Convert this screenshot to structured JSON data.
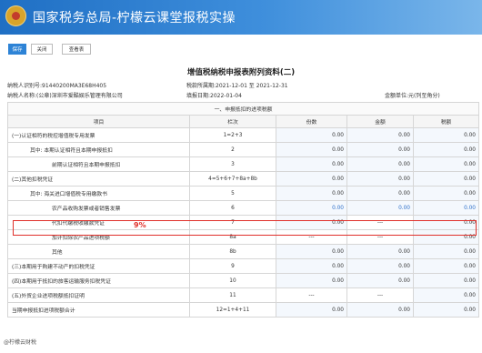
{
  "header": {
    "title": "国家税务总局-柠檬云课堂报税实操"
  },
  "toolbar": {
    "save": "保存",
    "close": "关闭",
    "view": "查看表"
  },
  "form": {
    "title": "增值税纳税申报表附列资料(二)",
    "taxpayer_id_label": "纳税人识别号:",
    "taxpayer_id": "91440200MA3E68H405",
    "period_label": "税款所属期:",
    "period": "2021-12-01 至 2021-12-31",
    "taxpayer_name_label": "纳税人名称:(公章)",
    "taxpayer_name": "深圳市爱酷娱乐管理有限公司",
    "fill_date_label": "填报日期:",
    "fill_date": "2022-01-04",
    "unit_label": "金额单位:",
    "unit": "元(列至角分)"
  },
  "table": {
    "section": "一、申报抵扣的进项税额",
    "headers": [
      "项目",
      "栏次",
      "份数",
      "金额",
      "税额"
    ],
    "rows": [
      {
        "item": "(一)认证相符的税控增值税专用发票",
        "line": "1=2+3",
        "copies": "0.00",
        "amount": "0.00",
        "tax": "0.00"
      },
      {
        "item": "其中: 本期认证相符且本期申报抵扣",
        "line": "2",
        "copies": "0.00",
        "amount": "0.00",
        "tax": "0.00"
      },
      {
        "item": "前期认证相符且本期申报抵扣",
        "line": "3",
        "copies": "0.00",
        "amount": "0.00",
        "tax": "0.00"
      },
      {
        "item": "(二)其他扣税凭证",
        "line": "4=5+6+7+8a+8b",
        "copies": "0.00",
        "amount": "0.00",
        "tax": "0.00"
      },
      {
        "item": "其中: 海关进口增值税专用缴款书",
        "line": "5",
        "copies": "0.00",
        "amount": "0.00",
        "tax": "0.00"
      },
      {
        "item": "农产品收购发票或者销售发票",
        "line": "6",
        "copies": "0.00",
        "amount": "0.00",
        "tax": "0.00"
      },
      {
        "item": "代扣代缴税收缴款凭证",
        "line": "7",
        "copies": "0.00",
        "amount": "---",
        "tax": "0.00"
      },
      {
        "item": "加计扣除农产品进项税额",
        "line": "8a",
        "copies": "---",
        "amount": "---",
        "tax": "0.00"
      },
      {
        "item": "其他",
        "line": "8b",
        "copies": "0.00",
        "amount": "0.00",
        "tax": "0.00"
      },
      {
        "item": "(三)本期用于购建不动产的扣税凭证",
        "line": "9",
        "copies": "0.00",
        "amount": "0.00",
        "tax": "0.00"
      },
      {
        "item": "(四)本期用于抵扣的旅客运输服务扣税凭证",
        "line": "10",
        "copies": "0.00",
        "amount": "0.00",
        "tax": "0.00"
      },
      {
        "item": "(五)外贸企业进项税额抵扣证明",
        "line": "11",
        "copies": "---",
        "amount": "---",
        "tax": "0.00"
      },
      {
        "item": "当期申报抵扣进项税额合计",
        "line": "12=1+4+11",
        "copies": "0.00",
        "amount": "0.00",
        "tax": "0.00"
      }
    ]
  },
  "annotation": {
    "rate": "9%"
  },
  "watermark": "@柠檬云财税"
}
